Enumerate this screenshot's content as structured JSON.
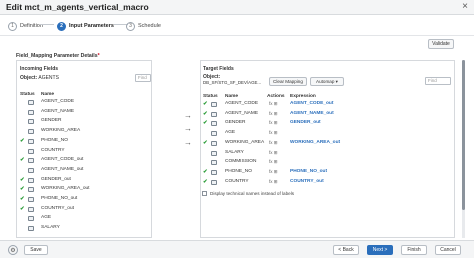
{
  "window": {
    "title": "Edit mct_m_agents_vertical_macro",
    "close_glyph": "×"
  },
  "steps": [
    {
      "num": "1",
      "label": "Definition",
      "active": false
    },
    {
      "num": "2",
      "label": "Input Parameters",
      "active": true
    },
    {
      "num": "3",
      "label": "Schedule",
      "active": false
    }
  ],
  "toolbar": {
    "validate_label": "Validate"
  },
  "section": {
    "title": "Field_Mapping Parameter Details",
    "required_mark": "*"
  },
  "incoming": {
    "heading": "Incoming Fields",
    "object_label": "Object:",
    "object_value": "AGENTS",
    "find_placeholder": "Find",
    "col_status": "Status",
    "col_name": "Name",
    "rows": [
      {
        "checked": false,
        "name": "AGENT_CODE"
      },
      {
        "checked": false,
        "name": "AGENT_NAME"
      },
      {
        "checked": false,
        "name": "GENDER"
      },
      {
        "checked": false,
        "name": "WORKING_AREA"
      },
      {
        "checked": true,
        "name": "PHONE_NO"
      },
      {
        "checked": false,
        "name": "COUNTRY"
      },
      {
        "checked": true,
        "name": "AGENT_CODE_out"
      },
      {
        "checked": false,
        "name": "AGENT_NAME_out"
      },
      {
        "checked": true,
        "name": "GENDER_out"
      },
      {
        "checked": true,
        "name": "WORKING_AREA_out"
      },
      {
        "checked": true,
        "name": "PHONE_NO_out"
      },
      {
        "checked": true,
        "name": "COUNTRY_out"
      },
      {
        "checked": false,
        "name": "AGE"
      },
      {
        "checked": false,
        "name": "SALARY"
      }
    ]
  },
  "target": {
    "heading": "Target Fields",
    "object_label": "Object:",
    "object_value": "DB_SF/STG_SF_DEV/AGE...",
    "clear_mapping_label": "Clear Mapping",
    "automap_label": "Automap ▾",
    "find_placeholder": "Find",
    "col_status": "Status",
    "col_name": "Name",
    "col_actions": "Actions",
    "col_expression": "Expression",
    "actions_glyph": "fx ⊞",
    "rows": [
      {
        "checked": true,
        "name": "AGENT_CODE",
        "expr": "AGENT_CODE_out"
      },
      {
        "checked": true,
        "name": "AGENT_NAME",
        "expr": "AGENT_NAME_out"
      },
      {
        "checked": true,
        "name": "GENDER",
        "expr": "GENDER_out"
      },
      {
        "checked": false,
        "name": "AGE",
        "expr": ""
      },
      {
        "checked": true,
        "name": "WORKING_AREA",
        "expr": "WORKING_AREA_out"
      },
      {
        "checked": false,
        "name": "SALARY",
        "expr": ""
      },
      {
        "checked": false,
        "name": "COMMISSION",
        "expr": ""
      },
      {
        "checked": true,
        "name": "PHONE_NO",
        "expr": "PHONE_NO_out"
      },
      {
        "checked": true,
        "name": "COUNTRY",
        "expr": "COUNTRY_out"
      }
    ],
    "display_technical_label": "Display technical names instead of labels"
  },
  "arrows": [
    "→",
    "→",
    "→"
  ],
  "footer": {
    "gear_glyph": "⚙",
    "save_label": "Save",
    "back_label": "< Back",
    "next_label": "Next >",
    "finish_label": "Finish",
    "cancel_label": "Cancel"
  },
  "colors": {
    "accent": "#2a6ebb",
    "check": "#2e9e3a",
    "required": "#d0021b"
  }
}
